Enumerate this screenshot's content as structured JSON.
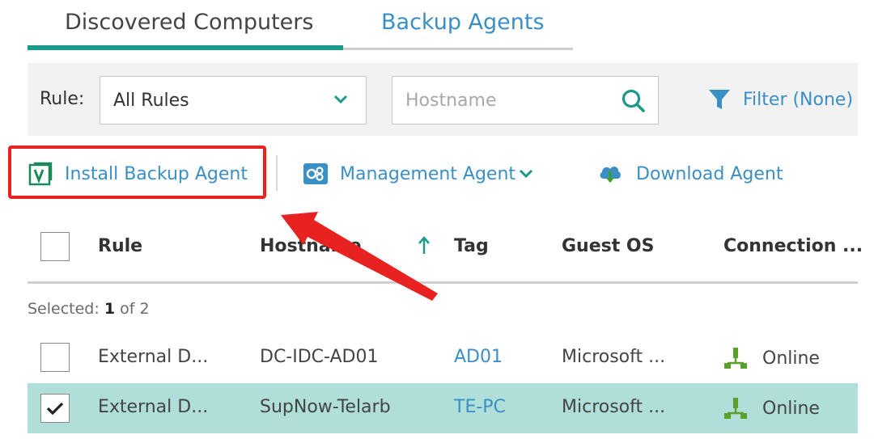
{
  "tabs": [
    {
      "label": "Discovered Computers",
      "active": true
    },
    {
      "label": "Backup Agents",
      "active": false
    }
  ],
  "filter": {
    "rule_label": "Rule:",
    "rule_value": "All Rules",
    "hostname_placeholder": "Hostname",
    "filter_label": "Filter (None)"
  },
  "toolbar": {
    "install_label": "Install Backup Agent",
    "management_label": "Management Agent",
    "download_label": "Download Agent"
  },
  "table": {
    "columns": [
      "Rule",
      "Hostname",
      "Tag",
      "Guest OS",
      "Connection ..."
    ],
    "sort": {
      "column": "Hostname",
      "direction": "ascending"
    },
    "selected_label": "Selected:",
    "selected_count": "1",
    "selected_of": "of 2",
    "rows": [
      {
        "checked": false,
        "rule": "External D...",
        "hostname": "DC-IDC-AD01",
        "tag": "AD01",
        "guest_os": "Microsoft ...",
        "connection": "Online"
      },
      {
        "checked": true,
        "rule": "External D...",
        "hostname": "SupNow-Telarb",
        "tag": "TE-PC",
        "guest_os": "Microsoft ...",
        "connection": "Online"
      }
    ]
  },
  "colors": {
    "accent": "#1a9a8a",
    "link": "#3a8fc4",
    "selected_row": "#b0dfd9",
    "highlight": "#e82121",
    "online_icon": "#5aa02c"
  },
  "icons": {
    "install": "veeam-v-icon",
    "management": "management-agent-icon",
    "download": "cloud-download-icon",
    "filter": "funnel-icon",
    "search": "search-icon",
    "online": "network-online-icon"
  }
}
